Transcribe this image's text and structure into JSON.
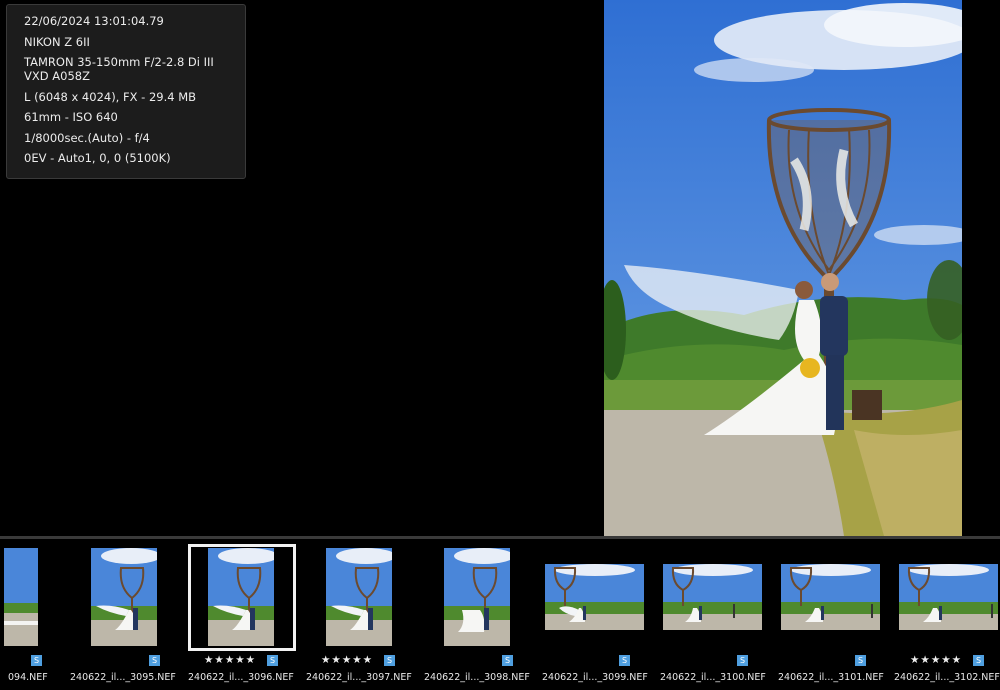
{
  "info": {
    "datetime": "22/06/2024 13:01:04.79",
    "camera": "NIKON Z 6II",
    "lens": "TAMRON 35-150mm F/2-2.8 Di III VXD A058Z",
    "image_size": "L (6048 x 4024), FX - 29.4 MB",
    "focal_iso": "61mm - ISO 640",
    "exposure": "1/8000sec.(Auto) - f/4",
    "white_balance": "0EV - Auto1, 0, 0 (5100K)"
  },
  "filmstrip": [
    {
      "name": "094.NEF",
      "stars": "",
      "badge": "S",
      "orientation": "portrait",
      "selected": false
    },
    {
      "name": "240622_il..._3095.NEF",
      "stars": "",
      "badge": "S",
      "orientation": "portrait",
      "selected": false
    },
    {
      "name": "240622_il..._3096.NEF",
      "stars": "★★★★★",
      "badge": "S",
      "orientation": "portrait",
      "selected": true
    },
    {
      "name": "240622_il..._3097.NEF",
      "stars": "★★★★★",
      "badge": "S",
      "orientation": "portrait",
      "selected": false
    },
    {
      "name": "240622_il..._3098.NEF",
      "stars": "",
      "badge": "S",
      "orientation": "portrait",
      "selected": false
    },
    {
      "name": "240622_il..._3099.NEF",
      "stars": "",
      "badge": "S",
      "orientation": "landscape",
      "selected": false
    },
    {
      "name": "240622_il..._3100.NEF",
      "stars": "",
      "badge": "S",
      "orientation": "landscape",
      "selected": false
    },
    {
      "name": "240622_il..._3101.NEF",
      "stars": "",
      "badge": "S",
      "orientation": "landscape",
      "selected": false
    },
    {
      "name": "240622_il..._3102.NEF",
      "stars": "★★★★★",
      "badge": "S",
      "orientation": "landscape",
      "selected": false
    }
  ],
  "colors": {
    "sky": "#3d7bd8",
    "grass": "#4f8a2e",
    "path": "#b9b3a6",
    "badge": "#4f9fe0"
  }
}
